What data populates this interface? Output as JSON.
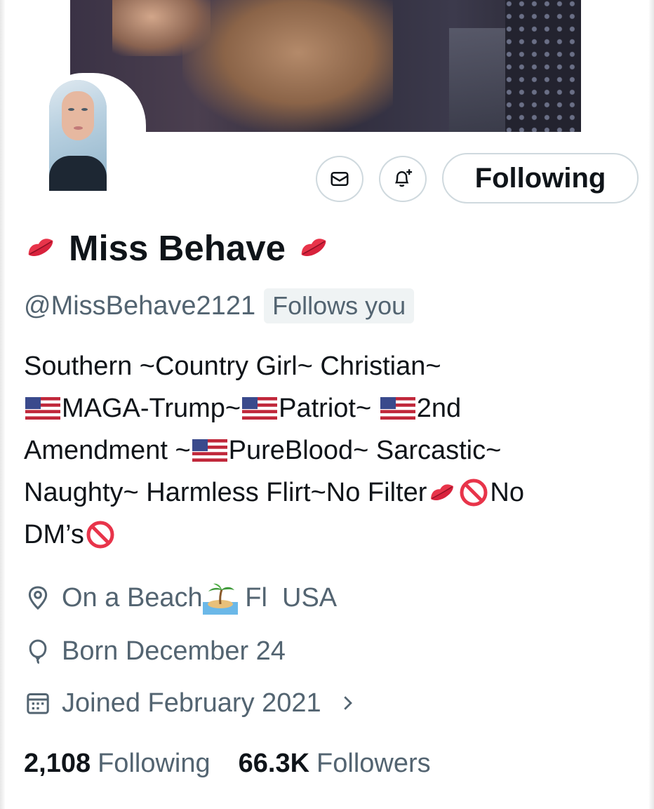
{
  "profile": {
    "display_name": "Miss Behave",
    "handle": "@MissBehave2121",
    "follows_you_badge": "Follows you",
    "bio_lines": [
      {
        "parts": [
          "Southern ~Country Girl~ Christian~"
        ]
      },
      {
        "parts": [
          "MAGA-Trump~",
          "Patriot~ ",
          "2nd"
        ]
      },
      {
        "parts": [
          "Amendment ~",
          "PureBlood~ Sarcastic~"
        ]
      },
      {
        "parts": [
          "Naughty~ Harmless Flirt~No Filter",
          "No"
        ]
      },
      {
        "parts": [
          "DM’s"
        ]
      }
    ],
    "location": "On a Beach",
    "location_suffix": " Fl  USA",
    "birthday": "Born December 24",
    "joined": "Joined February 2021",
    "following_count": "2,108",
    "following_label": "Following",
    "followers_count": "66.3K",
    "followers_label": "Followers"
  },
  "actions": {
    "follow_button_label": "Following"
  },
  "icons": {
    "message": "envelope-icon",
    "notify": "bell-plus-icon",
    "location": "location-pin-icon",
    "birthday": "balloon-icon",
    "joined": "calendar-icon",
    "joined_chevron": "chevron-right-icon",
    "emoji_lips": "kiss-mark-icon",
    "emoji_flag": "us-flag-icon",
    "emoji_no_entry": "prohibited-icon",
    "emoji_island": "desert-island-icon"
  },
  "colors": {
    "text_primary": "#0f1419",
    "text_secondary": "#536471",
    "border": "#cfd9de",
    "badge_bg": "#eff3f4"
  }
}
